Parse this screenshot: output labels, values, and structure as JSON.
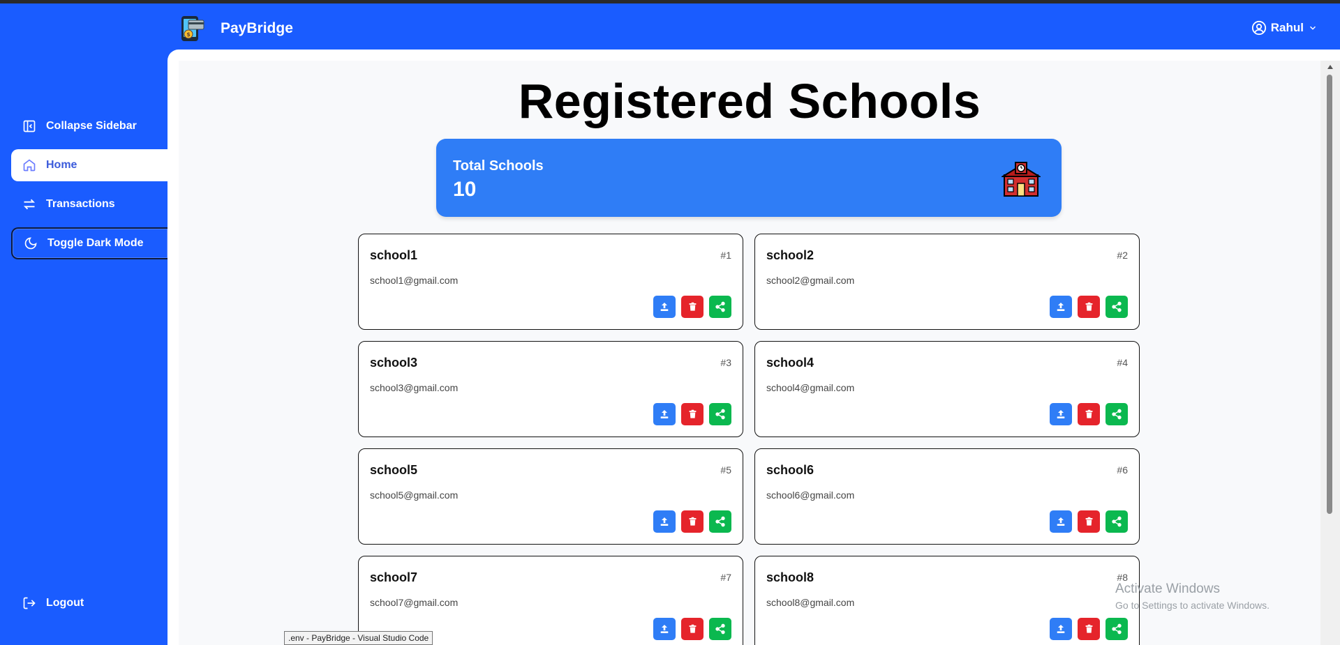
{
  "app": {
    "name": "PayBridge"
  },
  "header": {
    "user_name": "Rahul"
  },
  "sidebar": {
    "items": [
      {
        "label": "Collapse Sidebar",
        "icon": "collapse-sidebar-icon"
      },
      {
        "label": "Home",
        "icon": "home-icon",
        "active": true
      },
      {
        "label": "Transactions",
        "icon": "transactions-icon"
      },
      {
        "label": "Toggle Dark Mode",
        "icon": "moon-icon"
      }
    ],
    "logout_label": "Logout"
  },
  "page": {
    "title": "Registered Schools"
  },
  "summary": {
    "label": "Total Schools",
    "count": "10",
    "icon": "school-building-icon"
  },
  "schools": [
    {
      "name": "school1",
      "number": "#1",
      "email": "school1@gmail.com"
    },
    {
      "name": "school2",
      "number": "#2",
      "email": "school2@gmail.com"
    },
    {
      "name": "school3",
      "number": "#3",
      "email": "school3@gmail.com"
    },
    {
      "name": "school4",
      "number": "#4",
      "email": "school4@gmail.com"
    },
    {
      "name": "school5",
      "number": "#5",
      "email": "school5@gmail.com"
    },
    {
      "name": "school6",
      "number": "#6",
      "email": "school6@gmail.com"
    },
    {
      "name": "school7",
      "number": "#7",
      "email": "school7@gmail.com"
    },
    {
      "name": "school8",
      "number": "#8",
      "email": "school8@gmail.com"
    }
  ],
  "card_actions": [
    {
      "icon": "upload-icon",
      "color": "#2f7df6"
    },
    {
      "icon": "trash-icon",
      "color": "#e5242b"
    },
    {
      "icon": "share-icon",
      "color": "#0bb84f"
    }
  ],
  "colors": {
    "brand_blue": "#1a5cff",
    "card_blue": "#2f7df6",
    "danger": "#e5242b",
    "success": "#0bb84f"
  },
  "os_overlay": {
    "watermark_title": "Activate Windows",
    "watermark_subtitle": "Go to Settings to activate Windows.",
    "taskbar_tooltip": ".env - PayBridge - Visual Studio Code"
  }
}
